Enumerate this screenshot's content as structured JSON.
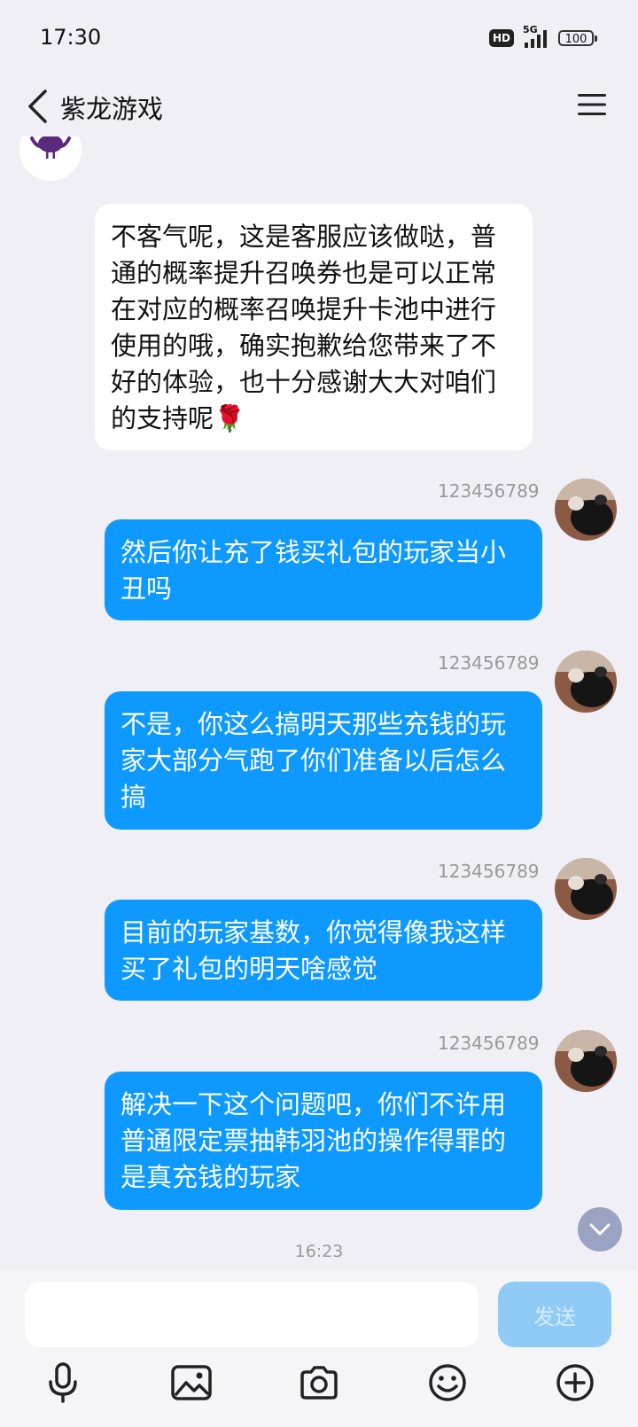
{
  "status_bar": {
    "time": "17:30",
    "hd": "HD",
    "network": "5G",
    "battery": "100"
  },
  "header": {
    "title": "紫龙游戏"
  },
  "messages": [
    {
      "side": "in",
      "text": "不客气呢，这是客服应该做哒，普通的概率提升召唤券也是可以正常在对应的概率召唤提升卡池中进行使用的哦，确实抱歉给您带来了不好的体验，也十分感谢大大对咱们的支持呢🌹"
    },
    {
      "side": "out",
      "sender": "123456789",
      "text": "然后你让充了钱买礼包的玩家当小丑吗"
    },
    {
      "side": "out",
      "sender": "123456789",
      "text": "不是，你这么搞明天那些充钱的玩家大部分气跑了你们准备以后怎么搞"
    },
    {
      "side": "out",
      "sender": "123456789",
      "text": "目前的玩家基数，你觉得像我这样买了礼包的明天啥感觉"
    },
    {
      "side": "out",
      "sender": "123456789",
      "text": "解决一下这个问题吧，你们不许用普通限定票抽韩羽池的操作得罪的是真充钱的玩家"
    }
  ],
  "timestamp": "16:23",
  "composer": {
    "input_value": "",
    "send_label": "发送"
  },
  "colors": {
    "background": "#f0eff5",
    "outgoing_bubble": "#0d99ff",
    "send_button_disabled": "#90cbf8"
  }
}
